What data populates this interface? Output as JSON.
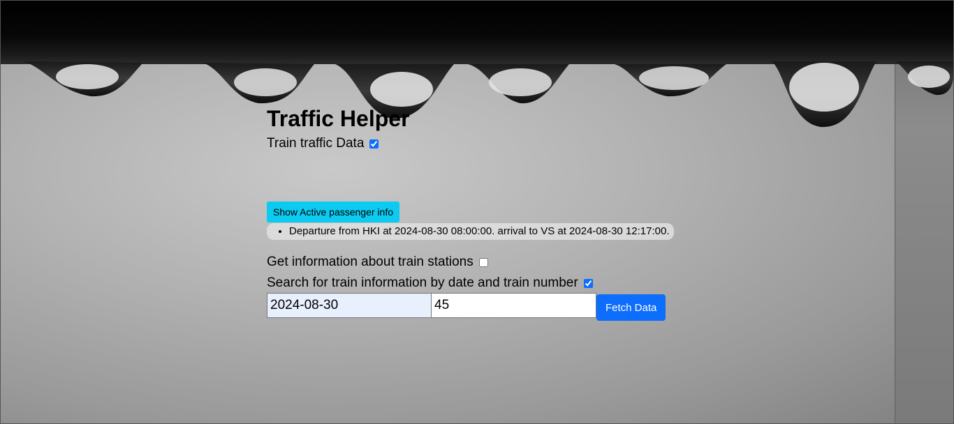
{
  "page": {
    "title": "Traffic Helper"
  },
  "toggles": {
    "train_traffic": {
      "label": "Train traffic Data",
      "checked": true
    },
    "stations": {
      "label": "Get information about train stations",
      "checked": false
    },
    "search": {
      "label": "Search for train information by date and train number",
      "checked": true
    }
  },
  "passenger": {
    "button_label": "Show Active passenger info",
    "items": [
      "Departure from HKI at 2024-08-30 08:00:00. arrival to VS at 2024-08-30 12:17:00."
    ]
  },
  "search_form": {
    "date_value": "2024-08-30",
    "train_number_value": "45",
    "fetch_label": "Fetch Data"
  },
  "colors": {
    "info_button": "#0dcaf0",
    "primary_button": "#0d6efd",
    "autofill_input": "#e8f0fe"
  },
  "background": {
    "icon": "water-droplets-photo"
  }
}
